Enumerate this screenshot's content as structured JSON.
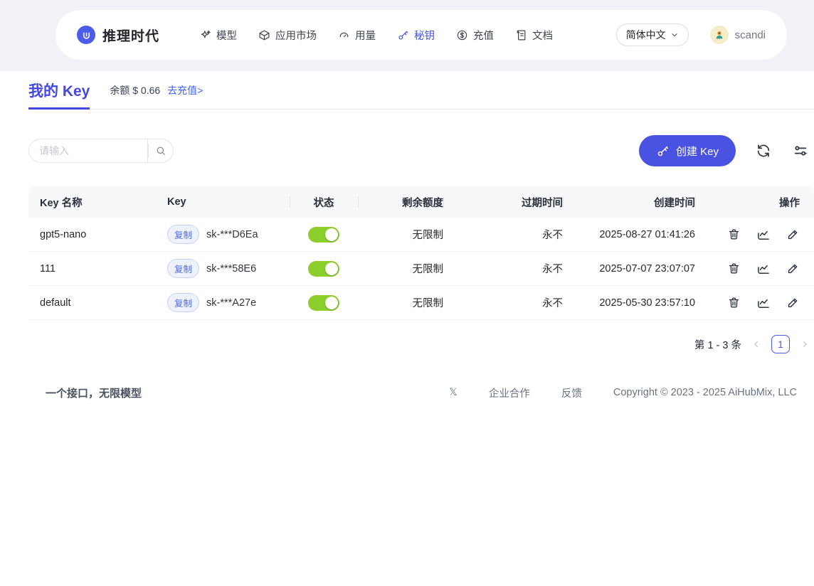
{
  "brand": {
    "name": "推理时代"
  },
  "nav": {
    "items": [
      {
        "label": "模型"
      },
      {
        "label": "应用市场"
      },
      {
        "label": "用量"
      },
      {
        "label": "秘钥"
      },
      {
        "label": "充值"
      },
      {
        "label": "文档"
      }
    ],
    "language": "简体中文",
    "username": "scandi"
  },
  "page": {
    "title": "我的 Key",
    "balance_label": "余额",
    "balance_amount": "$ 0.66",
    "balance_text": "余额 $ 0.66",
    "recharge_link": "去充值>"
  },
  "toolbar": {
    "search_placeholder": "请输入",
    "create_button_label": "创建 Key"
  },
  "table": {
    "headers": [
      "Key 名称",
      "Key",
      "状态",
      "剩余额度",
      "过期时间",
      "创建时间",
      "操作"
    ],
    "copy_label": "复制",
    "rows": [
      {
        "name": "gpt5-nano",
        "key_masked": "sk-***D6Ea",
        "status": "on",
        "quota": "无限制",
        "expires": "永不",
        "created": "2025-08-27 01:41:26"
      },
      {
        "name": "111",
        "key_masked": "sk-***58E6",
        "status": "on",
        "quota": "无限制",
        "expires": "永不",
        "created": "2025-07-07 23:07:07"
      },
      {
        "name": "default",
        "key_masked": "sk-***A27e",
        "status": "on",
        "quota": "无限制",
        "expires": "永不",
        "created": "2025-05-30 23:57:10"
      }
    ]
  },
  "pagination": {
    "summary": "第 1 - 3 条",
    "current_page": "1"
  },
  "footer": {
    "tagline": "一个接口，无限模型",
    "links": [
      {
        "label": "𝕏"
      },
      {
        "label": "企业合作"
      },
      {
        "label": "反馈"
      }
    ],
    "copyright": "Copyright © 2023 - 2025 AiHubMix, LLC"
  },
  "colors": {
    "accent_blue": "#4A52E1",
    "link_blue": "#3E63F6",
    "toggle_on_green": "#8CCF2C",
    "copy_badge_text": "#4D68E8",
    "copy_badge_bg": "#EEF2FE",
    "header_bg": "#F7F8FA",
    "top_band_bg": "#F1F2F6"
  }
}
